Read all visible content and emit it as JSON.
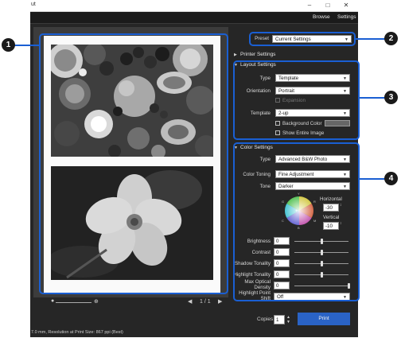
{
  "window": {
    "title": "ut"
  },
  "menu": {
    "browse": "Browse",
    "settings": "Settings"
  },
  "preset": {
    "label": "Preset",
    "value": "Current Settings"
  },
  "printer_settings": {
    "title": "Printer Settings"
  },
  "layout": {
    "title": "Layout Settings",
    "type_label": "Type",
    "type_value": "Template",
    "orientation_label": "Orientation",
    "orientation_value": "Portrait",
    "expansion_label": "Expansion",
    "template_label": "Template",
    "template_value": "2-up",
    "background_color_label": "Background Color",
    "show_entire_image_label": "Show Entire Image"
  },
  "color": {
    "title": "Color Settings",
    "type_label": "Type",
    "type_value": "Advanced B&W Photo",
    "toning_label": "Color Toning",
    "toning_value": "Fine Adjustment",
    "tone_label": "Tone",
    "tone_value": "Darker",
    "wheel_labels": {
      "y": "Y",
      "r": "R",
      "m": "M",
      "b": "B",
      "c": "C",
      "g": "G"
    },
    "horizontal_label": "Horizontal",
    "horizontal_value": "-30",
    "vertical_label": "Vertical",
    "vertical_value": "-10",
    "brightness_label": "Brightness",
    "brightness_value": "0",
    "brightness_level": 0.5,
    "contrast_label": "Contrast",
    "contrast_value": "0",
    "contrast_level": 0.5,
    "shadow_label": "Shadow Tonality",
    "shadow_value": "0",
    "shadow_level": 0.5,
    "highlight_label": "Highlight Tonality",
    "highlight_value": "0",
    "highlight_level": 0.5,
    "max_density_label": "Max Optical Density",
    "max_density_value": "0",
    "max_density_level": 1.0,
    "highlight_shift_label": "Highlight Point Shift",
    "highlight_shift_value": "Off"
  },
  "preview": {
    "page_indicator": "1 / 1"
  },
  "status": {
    "text": "7.0 mm,   Resolution at Print Size: 867 ppi (Best)"
  },
  "copies": {
    "label": "Copies",
    "value": "1"
  },
  "print_button": "Print",
  "callouts": [
    "1",
    "2",
    "3",
    "4"
  ]
}
